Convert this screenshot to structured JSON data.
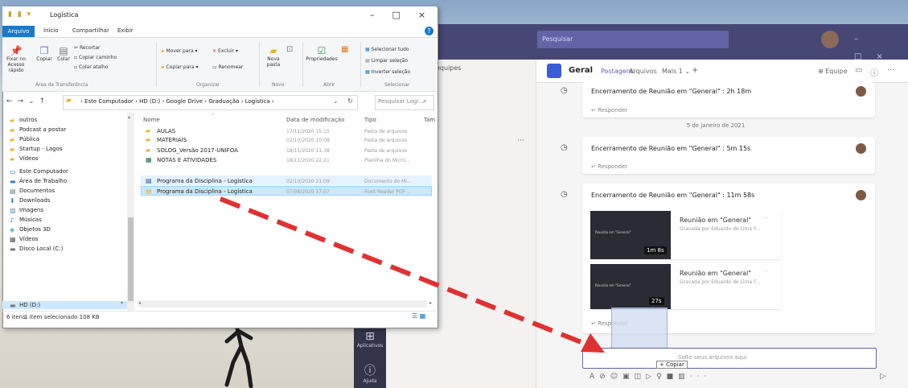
{
  "teams": {
    "search_placeholder": "Pesquisar",
    "list_row": "equipes",
    "list_dots": "···",
    "channel": {
      "name": "Geral",
      "tabs": [
        "Postagens",
        "Arquivos",
        "Mais 1"
      ],
      "team_button": "Equipe"
    },
    "rail": [
      {
        "label": "Aplicativos",
        "icon": "apps-icon"
      },
      {
        "label": "Ajuda",
        "icon": "help-icon"
      }
    ],
    "posts": [
      {
        "title": "Encerramento de Reunião em \"General\" : 2h 18m",
        "reply": "Responder"
      },
      {
        "title": "Encerramento de Reunião em \"General\" : 5m 15s",
        "reply": "Responder"
      },
      {
        "title": "Encerramento de Reunião em \"General\" : 11m 58s",
        "reply": "Responder"
      }
    ],
    "date_separator": "5 de janeiro de 2021",
    "recordings": [
      {
        "title": "Reunião em \"General\"",
        "subtitle": "Gravada por Eduardo de Lima F...",
        "duration": "1m 8s",
        "thumb_title": "Reunião em \"General\""
      },
      {
        "title": "Reunião em \"General\"",
        "subtitle": "Gravada por Eduardo de Lima F...",
        "duration": "27s",
        "thumb_title": "Reunião em \"General\""
      }
    ],
    "compose_placeholder": "Solte seus arquivos aqui",
    "copy_tooltip": "+ Copiar"
  },
  "explorer": {
    "title": "Logística",
    "ribbon_tabs": [
      "Arquivo",
      "Início",
      "Compartilhar",
      "Exibir"
    ],
    "ribbon_groups": [
      "Área de Transferência",
      "Organizar",
      "Novo",
      "Abrir",
      "Selecionar"
    ],
    "ribbon_buttons": {
      "pin": "Fixar no Acesso rápido",
      "copy": "Copiar",
      "paste": "Colar",
      "cut": "Recortar",
      "copy_path": "Copiar caminho",
      "paste_shortcut": "Colar atalho",
      "move_to": "Mover para",
      "copy_to": "Copiar para",
      "delete": "Excluir",
      "rename": "Renomear",
      "new_folder": "Nova pasta",
      "properties": "Propriedades",
      "select_all": "Selecionar tudo",
      "clear_selection": "Limpar seleção",
      "invert_selection": "Inverter seleção"
    },
    "path": [
      "Este Computador",
      "HD (D:)",
      "Google Drive",
      "Graduação",
      "Logística"
    ],
    "search_placeholder": "Pesquisar Logí...",
    "nav_items": [
      {
        "label": "outros",
        "icon": "folder-icon"
      },
      {
        "label": "Podcast a postar",
        "icon": "folder-icon"
      },
      {
        "label": "Pública",
        "icon": "folder-icon"
      },
      {
        "label": "Startup - Lagos",
        "icon": "folder-icon"
      },
      {
        "label": "Vídeos",
        "icon": "folder-icon"
      },
      {
        "label": "Este Computador",
        "icon": "computer-icon"
      },
      {
        "label": "Área de Trabalho",
        "icon": "desktop-icon"
      },
      {
        "label": "Documentos",
        "icon": "documents-icon"
      },
      {
        "label": "Downloads",
        "icon": "download-icon"
      },
      {
        "label": "Imagens",
        "icon": "images-icon"
      },
      {
        "label": "Músicas",
        "icon": "music-icon"
      },
      {
        "label": "Objetos 3D",
        "icon": "objects3d-icon"
      },
      {
        "label": "Vídeos",
        "icon": "video-icon"
      },
      {
        "label": "Disco Local (C:)",
        "icon": "drive-icon"
      },
      {
        "label": "HD (D:)",
        "icon": "drive-icon"
      }
    ],
    "columns": [
      "Nome",
      "Data de modificação",
      "Tipo",
      "Tam"
    ],
    "files": [
      {
        "name": "AULAS",
        "date": "17/11/2020 15:15",
        "type": "Pasta de arquivos",
        "icon": "folder-icon"
      },
      {
        "name": "MATERIAIS",
        "date": "02/10/2020 10:08",
        "type": "Pasta de arquivos",
        "icon": "folder-icon"
      },
      {
        "name": "SOLOG_Versão 2017-UNIFOA",
        "date": "18/11/2020 11:38",
        "type": "Pasta de arquivos",
        "icon": "folder-icon"
      },
      {
        "name": "NOTAS E ATIVIDADES",
        "date": "18/11/2020 22:21",
        "type": "Planilha do Micro...",
        "icon": "spreadsheet-icon"
      },
      {
        "name": "Programa da Disciplina - Logística",
        "date": "02/10/2020 21:09",
        "type": "Documento do Mi...",
        "icon": "word-icon"
      },
      {
        "name": "Programa da Disciplina - Logística",
        "date": "07/08/2020 17:07",
        "type": "Foxit Reader PDF ...",
        "icon": "pdf-icon"
      }
    ],
    "status": {
      "count": "6 itens",
      "selected": "1 item selecionado  108 KB"
    }
  },
  "colors": {
    "teams_purple": "#464775",
    "accent": "#6264a7",
    "explorer_blue": "#1979ca",
    "arrow_red": "#e03131"
  }
}
